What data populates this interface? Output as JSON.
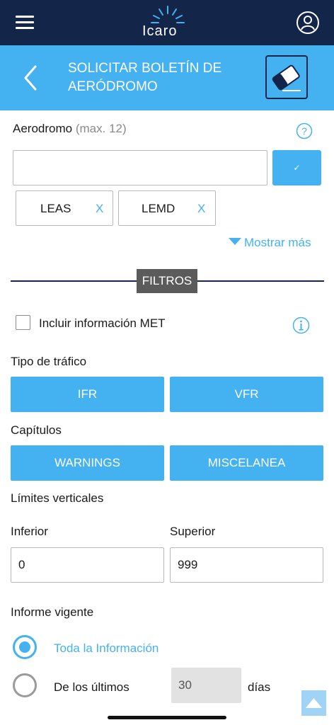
{
  "topbar": {
    "logo_text": "Icaro",
    "menu_icon": "hamburger-menu-icon",
    "user_icon": "user-circle-icon",
    "background": "#14254a"
  },
  "header": {
    "title": "SOLICITAR BOLETÍN DE AERÓDROMO",
    "back_icon": "chevron-left-icon",
    "clear_icon": "eraser-icon",
    "background": "#44b1f1"
  },
  "aerodrome": {
    "label": "Aerodromo",
    "hint": "(max. 12)",
    "help_icon": "question-circle-icon",
    "input_value": "",
    "input_placeholder": "",
    "confirm_label": "✓",
    "chips": [
      {
        "code": "LEAS",
        "remove": "X"
      },
      {
        "code": "LEMD",
        "remove": "X"
      }
    ],
    "show_more": "Mostrar más"
  },
  "filters": {
    "title": "FILTROS",
    "met_label": "Incluir información MET",
    "met_checked": false,
    "info_icon": "info-circle-icon"
  },
  "traffic": {
    "label": "Tipo de tráfico",
    "options": [
      "IFR",
      "VFR"
    ]
  },
  "chapters": {
    "label": "Capítulos",
    "options": [
      "WARNINGS",
      "MISCELANEA"
    ]
  },
  "vertical_limits": {
    "label": "Límites verticales",
    "lower_label": "Inferior",
    "lower_value": "0",
    "upper_label": "Superior",
    "upper_value": "999"
  },
  "report": {
    "label": "Informe vigente",
    "option_all": "Toda la Información",
    "option_last": "De los últimos",
    "days_value": "30",
    "days_unit": "días",
    "selected": "all"
  },
  "scroll_top_icon": "arrow-up-icon",
  "colors": {
    "accent": "#44b1f1",
    "navy": "#14254a",
    "tag": "#5b5b5b"
  }
}
